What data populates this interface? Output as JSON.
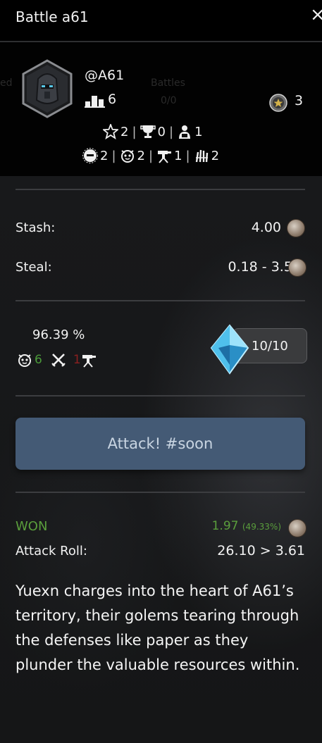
{
  "window": {
    "title": "Battle a61",
    "close_glyph": "×"
  },
  "background_text": {
    "left": "ed",
    "middle": "Battles",
    "middle_sub": "0/0"
  },
  "profile": {
    "username": "@A61",
    "rank": "6",
    "badge_count": "3"
  },
  "stats_row1": [
    {
      "icon": "star-trophy-icon",
      "value": "2"
    },
    {
      "icon": "chalice-icon",
      "value": "0"
    },
    {
      "icon": "worker-icon",
      "value": "1"
    }
  ],
  "stats_row2": [
    {
      "icon": "helmet-icon",
      "value": "2"
    },
    {
      "icon": "golem-icon",
      "value": "2"
    },
    {
      "icon": "turret-icon",
      "value": "1"
    },
    {
      "icon": "claw-icon",
      "value": "2"
    }
  ],
  "resources": {
    "stash_label": "Stash:",
    "stash_value": "4.00",
    "steal_label": "Steal:",
    "steal_value": "0.18 - 3.53"
  },
  "odds": {
    "percent": "96.39 %",
    "golems": "6",
    "turrets": "1"
  },
  "energy": {
    "value": "10/10"
  },
  "action": {
    "attack_label": "Attack! #soon"
  },
  "result": {
    "status": "WON",
    "amount": "1.97",
    "amount_pct": "(49.33%)",
    "roll_label": "Attack Roll:",
    "roll_value": "26.10 > 3.61"
  },
  "story": "Yuexn charges into the heart of A61’s territory, their golems tearing through the defenses like paper as they plunder the valuable resources within.",
  "colors": {
    "won": "#5a9e3c",
    "attack_button": "#445a75",
    "turret_count": "#8b2020",
    "golem_count": "#4b9a3a"
  }
}
